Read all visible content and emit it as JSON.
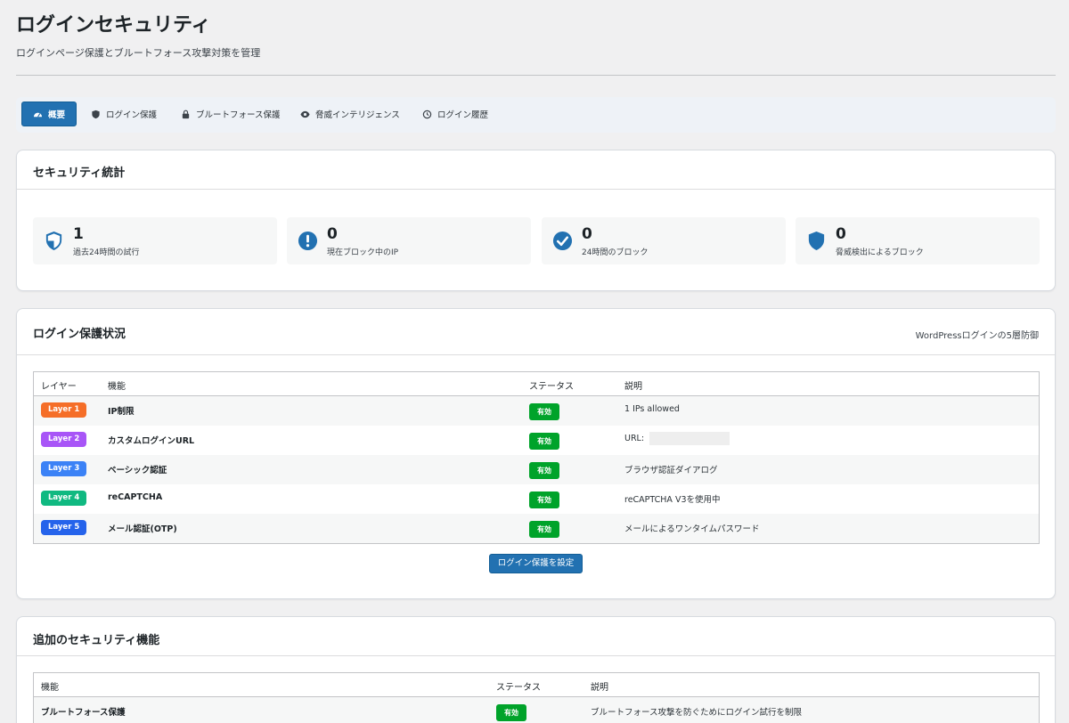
{
  "page": {
    "title": "ログインセキュリティ",
    "subtitle": "ログインページ保護とブルートフォース攻撃対策を管理"
  },
  "tabs": [
    {
      "label": "概要",
      "icon": "dashboard-icon",
      "active": true
    },
    {
      "label": "ログイン保護",
      "icon": "shield-icon"
    },
    {
      "label": "ブルートフォース保護",
      "icon": "lock-icon"
    },
    {
      "label": "脅威インテリジェンス",
      "icon": "eye-icon"
    },
    {
      "label": "ログイン履歴",
      "icon": "history-icon"
    }
  ],
  "stats_card": {
    "title": "セキュリティ統計",
    "stats": [
      {
        "value": "1",
        "label": "過去24時間の試行",
        "icon": "shield-check-icon"
      },
      {
        "value": "0",
        "label": "現在ブロック中のIP",
        "icon": "alert-circle-icon"
      },
      {
        "value": "0",
        "label": "24時間のブロック",
        "icon": "check-circle-icon"
      },
      {
        "value": "0",
        "label": "脅威検出によるブロック",
        "icon": "shield-icon"
      }
    ],
    "icon_color": "#2271b1"
  },
  "protection_card": {
    "title": "ログイン保護状況",
    "meta": "WordPressログインの5層防御",
    "headers": {
      "layer": "レイヤー",
      "feature": "機能",
      "status": "ステータス",
      "description": "説明"
    },
    "rows": [
      {
        "layer": "Layer 1",
        "color": "#f56e28",
        "feature": "IP制限",
        "status": "有効",
        "description": "1 IPs allowed"
      },
      {
        "layer": "Layer 2",
        "color": "#a855f7",
        "feature": "カスタムログインURL",
        "status": "有効",
        "description": "URL:"
      },
      {
        "layer": "Layer 3",
        "color": "#3b82f6",
        "feature": "ベーシック認証",
        "status": "有効",
        "description": "ブラウザ認証ダイアログ"
      },
      {
        "layer": "Layer 4",
        "color": "#10b981",
        "feature": "reCAPTCHA",
        "status": "有効",
        "description": "reCAPTCHA V3を使用中"
      },
      {
        "layer": "Layer 5",
        "color": "#2563eb",
        "feature": "メール認証(OTP)",
        "status": "有効",
        "description": "メールによるワンタイムパスワード"
      }
    ],
    "button_label": "ログイン保護を設定"
  },
  "additional_card": {
    "title": "追加のセキュリティ機能",
    "headers": {
      "feature": "機能",
      "status": "ステータス",
      "description": "説明"
    },
    "rows": [
      {
        "feature": "ブルートフォース保護",
        "status": "有効",
        "description": "ブルートフォース攻撃を防ぐためにログイン試行を制限"
      }
    ]
  },
  "colors": {
    "accent": "#2271b1",
    "success": "#00a32a"
  }
}
